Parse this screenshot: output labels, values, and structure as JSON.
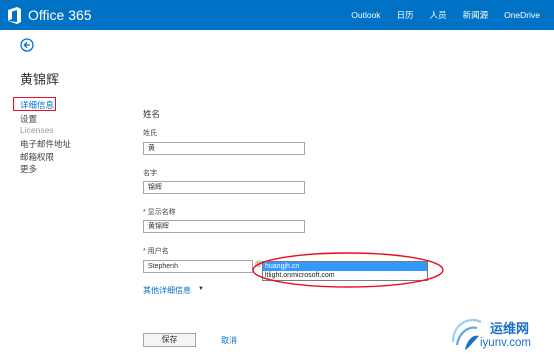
{
  "header": {
    "app_name": "Office 365",
    "nav": [
      "Outlook",
      "日历",
      "人员",
      "新闻源",
      "OneDrive"
    ]
  },
  "page": {
    "title": "黄锦辉"
  },
  "sidebar": {
    "items": [
      {
        "label": "详细信息",
        "state": "active"
      },
      {
        "label": "设置",
        "state": "normal"
      },
      {
        "label": "Licenses",
        "state": "disabled"
      },
      {
        "label": "电子邮件地址",
        "state": "normal"
      },
      {
        "label": "邮箱权限",
        "state": "normal"
      },
      {
        "label": "更多",
        "state": "normal"
      }
    ]
  },
  "form": {
    "section_title": "姓名",
    "surname_label": "姓氏",
    "surname_value": "黄",
    "given_label": "名字",
    "given_value": "锦辉",
    "display_label": "* 显示名称",
    "display_value": "黄锦辉",
    "username_label": "* 用户名",
    "username_value": "Stephenh",
    "at_sign": "@",
    "domain_options": [
      "huangjh.cn",
      "ltlight.onmicrosoft.com"
    ],
    "selected_domain_index": 0,
    "more_details": "其他详细信息",
    "save": "保存",
    "cancel": "取消"
  },
  "watermark": {
    "title": "运维网",
    "url": "iyunv.com"
  },
  "colors": {
    "brand": "#0072c6",
    "highlight": "#e81123",
    "selection": "#3399ff"
  }
}
